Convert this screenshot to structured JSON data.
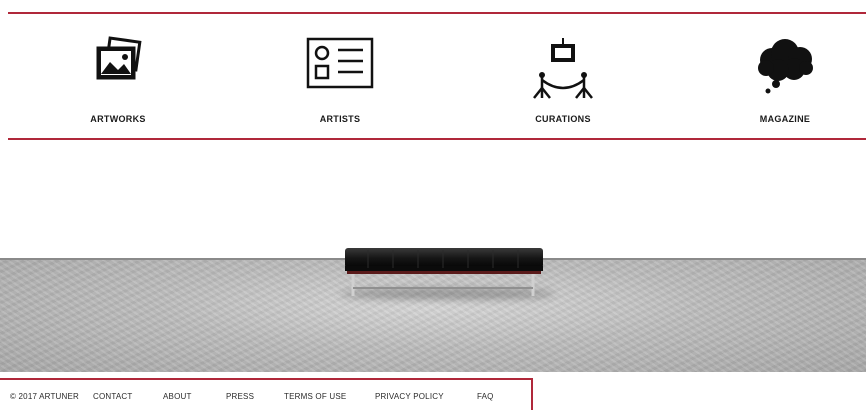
{
  "nav": {
    "items": [
      {
        "label": "ARTWORKS",
        "icon": "framed-pictures-icon"
      },
      {
        "label": "ARTISTS",
        "icon": "artist-card-icon"
      },
      {
        "label": "CURATIONS",
        "icon": "gallery-rope-icon"
      },
      {
        "label": "MAGAZINE",
        "icon": "thought-cloud-icon"
      }
    ],
    "accent_color": "#b0283a"
  },
  "footer": {
    "copyright": "© 2017 ARTUNER",
    "links": [
      "CONTACT",
      "ABOUT",
      "PRESS",
      "TERMS OF USE",
      "PRIVACY POLICY",
      "FAQ"
    ]
  }
}
